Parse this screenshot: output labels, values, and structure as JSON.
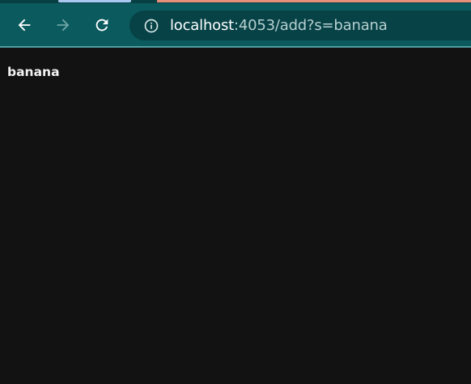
{
  "browser": {
    "colors": {
      "toolbar": "#0b5a5e",
      "omnibox": "#064246",
      "tab_accent_active": "#a9c8f0",
      "tab_accent_other": "#e6907c",
      "page_background": "#121212"
    },
    "nav": {
      "back_icon": "arrow-left-icon",
      "forward_icon": "arrow-right-icon",
      "reload_icon": "reload-icon"
    },
    "address_bar": {
      "site_info_icon": "info-icon",
      "host": "localhost",
      "rest": ":4053/add?s=banana"
    }
  },
  "page": {
    "content_text": "banana"
  }
}
